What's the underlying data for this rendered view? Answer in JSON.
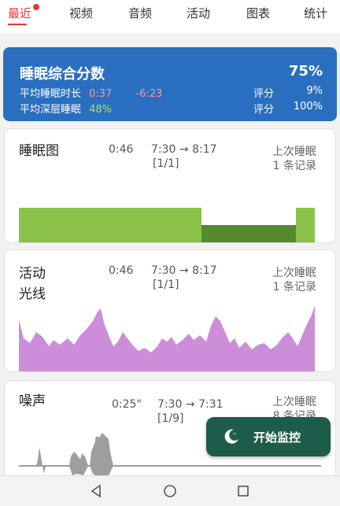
{
  "tabs": [
    {
      "label": "最近"
    },
    {
      "label": "视频"
    },
    {
      "label": "音频"
    },
    {
      "label": "活动"
    },
    {
      "label": "图表"
    },
    {
      "label": "统计"
    }
  ],
  "summary": {
    "title": "睡眠综合分数",
    "percent": "75%",
    "avg_duration_label": "平均睡眠时长",
    "avg_duration_value": "0:37",
    "avg_duration_diff": "-6:23",
    "avg_deep_label": "平均深层睡眠",
    "avg_deep_value": "48%",
    "score_label_1": "评分",
    "score_value_1": "9%",
    "score_label_2": "评分",
    "score_value_2": "100%"
  },
  "sleep_card": {
    "title": "睡眠图",
    "duration": "0:46",
    "range": "7:30 → 8:17",
    "count": "[1/1]",
    "last_label": "上次睡眠",
    "records": "1 条记录"
  },
  "activity_card": {
    "title_line1": "活动",
    "title_line2": "光线",
    "duration": "0:46",
    "range": "7:30 → 8:17",
    "count": "[1/1]",
    "last_label": "上次睡眠",
    "records": "1 条记录"
  },
  "noise_card": {
    "title": "噪声",
    "duration": "0:25\"",
    "range": "7:30 → 7:31",
    "count": "[1/9]",
    "last_label": "上次睡眠",
    "records": "8 条记录"
  },
  "fab": {
    "label": "开始监控",
    "icon": "moon-bird-icon"
  },
  "colors": {
    "accent": "#e53935",
    "summary_bg": "#2a6fbf",
    "sleep_light": "#8bc34a",
    "sleep_deep": "#558b2f",
    "activity": "#cc8ed8",
    "noise": "#9e9e9e",
    "fab_bg": "#1d5c4a"
  }
}
